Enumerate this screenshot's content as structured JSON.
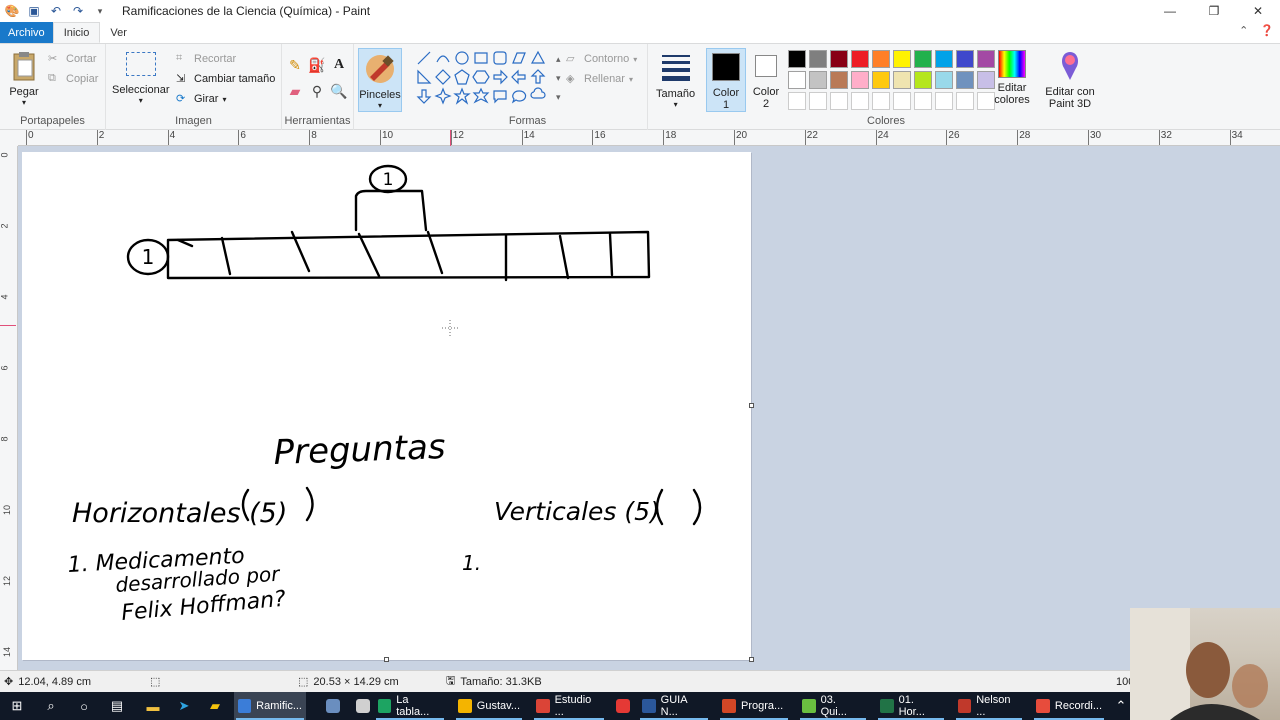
{
  "window": {
    "title": "Ramificaciones de la Ciencia (Química) - Paint",
    "minimize": "—",
    "maximize": "❐",
    "close": "✕"
  },
  "tabs": [
    {
      "label": "Archivo"
    },
    {
      "label": "Inicio"
    },
    {
      "label": "Ver"
    }
  ],
  "ribbon": {
    "clipboard": {
      "group": "Portapapeles",
      "paste": "Pegar",
      "cut": "Cortar",
      "copy": "Copiar"
    },
    "image": {
      "group": "Imagen",
      "select": "Seleccionar",
      "crop": "Recortar",
      "resize": "Cambiar tamaño",
      "rotate": "Girar"
    },
    "tools": {
      "group": "Herramientas"
    },
    "brushes": {
      "label": "Pinceles"
    },
    "shapes": {
      "group": "Formas",
      "outline": "Contorno",
      "fill": "Rellenar"
    },
    "size": {
      "label": "Tamaño"
    },
    "color1": {
      "label": "Color 1",
      "value": "#000000"
    },
    "color2": {
      "label": "Color 2",
      "value": "#ffffff"
    },
    "colors": {
      "group": "Colores",
      "edit": "Editar colores",
      "paint3d": "Editar con Paint 3D"
    },
    "palette_row1": [
      "#000000",
      "#7f7f7f",
      "#880015",
      "#ed1c24",
      "#ff7f27",
      "#fff200",
      "#22b14c",
      "#00a2e8",
      "#3f48cc",
      "#a349a4"
    ],
    "palette_row2": [
      "#ffffff",
      "#c3c3c3",
      "#b97a57",
      "#ffaec9",
      "#ffc90e",
      "#efe4b0",
      "#b5e61d",
      "#99d9ea",
      "#7092be",
      "#c8bfe7"
    ],
    "palette_row3": [
      "#ffffff",
      "#ffffff",
      "#ffffff",
      "#ffffff",
      "#ffffff",
      "#ffffff",
      "#ffffff",
      "#ffffff",
      "#ffffff",
      "#ffffff"
    ]
  },
  "ruler": {
    "h_ticks": [
      "0",
      "2",
      "4",
      "6",
      "8",
      "10",
      "12",
      "14",
      "16",
      "18",
      "20",
      "22",
      "24",
      "26",
      "28",
      "30",
      "32",
      "34"
    ],
    "v_ticks": [
      "0",
      "2",
      "4",
      "6",
      "8",
      "10",
      "12",
      "14"
    ]
  },
  "drawing": {
    "circle1_top": "1",
    "circle1_left": "1",
    "heading": "Preguntas",
    "horizontal_label": "Horizontales (5)",
    "vertical_label": "Verticales (5)",
    "q1_line1": "1. Medicamento",
    "q1_line2": "desarrollado por",
    "q1_line3": "Felix Hoffman?",
    "v1_label": "1."
  },
  "status": {
    "cursor_pos": "12.04, 4.89 cm",
    "selection_size": "20.53 × 14.29 cm",
    "file_size": "Tamaño: 31.3KB",
    "zoom": "100%"
  },
  "taskbar": {
    "apps": [
      {
        "label": "Ramific...",
        "color": "#3b7dd8"
      },
      {
        "label": "La tabla...",
        "color": "#1da462"
      },
      {
        "label": "Gustav...",
        "color": "#f4b400"
      },
      {
        "label": "Estudio ...",
        "color": "#db4437"
      },
      {
        "label": "GUIA N...",
        "color": "#2b579a"
      },
      {
        "label": "Progra...",
        "color": "#d24726"
      },
      {
        "label": "03. Qui...",
        "color": "#6abf40"
      },
      {
        "label": "01. Hor...",
        "color": "#217346"
      },
      {
        "label": "Nelson ...",
        "color": "#c0392b"
      },
      {
        "label": "Recordi...",
        "color": "#e74c3c"
      }
    ]
  }
}
